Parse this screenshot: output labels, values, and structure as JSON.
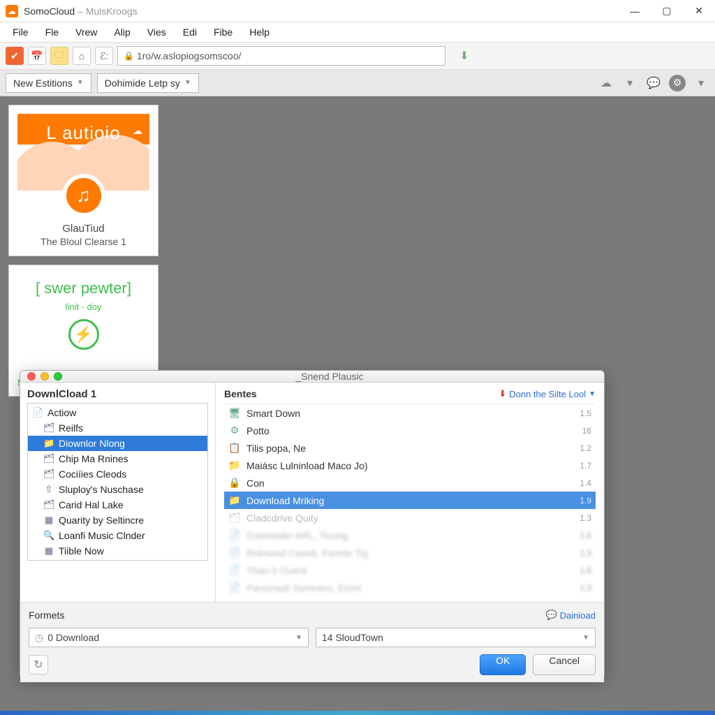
{
  "window": {
    "app_name": "SomoCloud",
    "subtitle": "MulsKroogs"
  },
  "menu": [
    "File",
    "Fle",
    "Vrew",
    "Alip",
    "Vies",
    "Edi",
    "Fibe",
    "Help"
  ],
  "url": "1ro/w.aslopiogsomscoo/",
  "subtoolbar": {
    "btn1": "New Estitions",
    "btn2": "Dohimide Letp sy"
  },
  "card1": {
    "brand": "L autioio",
    "title": "GlauTiud",
    "subtitle": "The Bloul Clearse 1"
  },
  "card2": {
    "big": "[ swer pewter]",
    "small": "linit - doy",
    "link": "Mw"
  },
  "dialog": {
    "title": "_Snend Plausic",
    "side_header": "DownlCload 1",
    "tree": [
      {
        "icon": "📄",
        "label": "Actiow",
        "indent": 0,
        "sel": false
      },
      {
        "icon": "🗂",
        "label": "Reilfs",
        "indent": 1,
        "sel": false
      },
      {
        "icon": "📁",
        "label": "Diownlor Nlong",
        "indent": 1,
        "sel": true
      },
      {
        "icon": "🗂",
        "label": "Chip Ma Rnines",
        "indent": 1,
        "sel": false
      },
      {
        "icon": "🗂",
        "label": "Cociíies Cleods",
        "indent": 1,
        "sel": false
      },
      {
        "icon": "⇧",
        "label": "Sluploy's Nuschase",
        "indent": 1,
        "sel": false
      },
      {
        "icon": "🗂",
        "label": "Carid Hal Lake",
        "indent": 1,
        "sel": false
      },
      {
        "icon": "▦",
        "label": "Quarity by Seltincre",
        "indent": 1,
        "sel": false
      },
      {
        "icon": "🔍",
        "label": "Loanfi Music Clnder",
        "indent": 1,
        "sel": false
      },
      {
        "icon": "▦",
        "label": "Tiible Now",
        "indent": 1,
        "sel": false
      }
    ],
    "main_header": "Bentes",
    "dropdown_link": "Donn the Silte Lool",
    "files": [
      {
        "icon": "🖥",
        "label": "Smart Down",
        "size": "1.5",
        "dim": false,
        "sel": false,
        "blur": false
      },
      {
        "icon": "⚙",
        "label": "Potto",
        "size": "16",
        "dim": false,
        "sel": false,
        "blur": false
      },
      {
        "icon": "📋",
        "label": "Tilis popa, Ne",
        "size": "1.2",
        "dim": false,
        "sel": false,
        "blur": false
      },
      {
        "icon": "📁",
        "label": "Maiásc Lulninload Maco Jo)",
        "size": "1.7",
        "dim": false,
        "sel": false,
        "blur": false
      },
      {
        "icon": "🔒",
        "label": "Con",
        "size": "1.4",
        "dim": false,
        "sel": false,
        "blur": false
      },
      {
        "icon": "📁",
        "label": "Download Mriking",
        "size": "1.9",
        "dim": false,
        "sel": true,
        "blur": false
      },
      {
        "icon": "🗂",
        "label": "Cladcdrive Quity",
        "size": "1.3",
        "dim": true,
        "sel": false,
        "blur": false
      },
      {
        "icon": "📄",
        "label": "Downsider ARL, Ticong",
        "size": "1.5",
        "dim": true,
        "sel": false,
        "blur": true
      },
      {
        "icon": "📄",
        "label": "Rolmond Casott, Fonnte Tig",
        "size": "1.3",
        "dim": true,
        "sel": false,
        "blur": true
      },
      {
        "icon": "📄",
        "label": "Than 0 Ouent",
        "size": "1.6",
        "dim": true,
        "sel": false,
        "blur": true
      },
      {
        "icon": "📄",
        "label": "Pavionadt Somnero, Eront",
        "size": "1.3",
        "dim": true,
        "sel": false,
        "blur": true
      }
    ],
    "formats_label": "Formets",
    "download_hint": "Dainioad",
    "select1": "0 Download",
    "select2": "14 SloudTown",
    "ok": "OK",
    "cancel": "Cancel"
  }
}
